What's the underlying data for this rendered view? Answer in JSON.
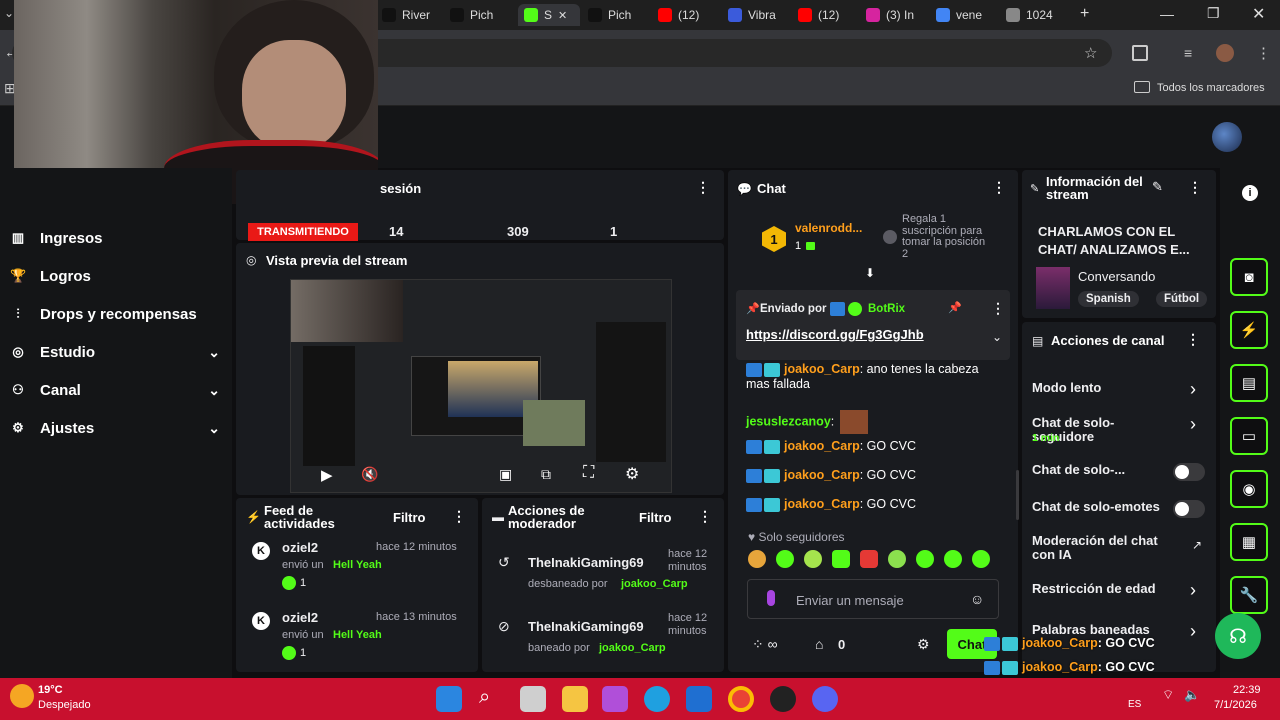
{
  "browser": {
    "tabs": [
      {
        "label": "River",
        "icon": "tiktok-icon"
      },
      {
        "label": "Pich",
        "icon": "tiktok-icon"
      },
      {
        "label": "S",
        "icon": "kick-icon",
        "active": true
      },
      {
        "label": "Pich",
        "icon": "tiktok-icon"
      },
      {
        "label": "(12)",
        "icon": "youtube-icon"
      },
      {
        "label": "Vibra",
        "icon": "gear-icon"
      },
      {
        "label": "(12)",
        "icon": "youtube-icon"
      },
      {
        "label": "(3) In",
        "icon": "instagram-icon"
      },
      {
        "label": "vene",
        "icon": "google-icon"
      },
      {
        "label": "1024",
        "icon": "globe-icon"
      }
    ],
    "new_tab": "+",
    "bookmarks_folder": "Todos los marcadores"
  },
  "session": {
    "title": "sesión",
    "status": "TRANSMITIENDO",
    "stats": [
      "14",
      "309",
      "1"
    ]
  },
  "nav": {
    "items": [
      {
        "label": "Ingresos",
        "icon": "chart-icon",
        "expandable": false
      },
      {
        "label": "Logros",
        "icon": "trophy-icon",
        "expandable": false
      },
      {
        "label": "Drops y recompensas",
        "icon": "drops-icon",
        "expandable": false
      },
      {
        "label": "Estudio",
        "icon": "studio-icon",
        "expandable": true
      },
      {
        "label": "Canal",
        "icon": "users-icon",
        "expandable": true
      },
      {
        "label": "Ajustes",
        "icon": "gear-icon",
        "expandable": true
      }
    ]
  },
  "preview": {
    "title": "Vista previa del stream"
  },
  "feed": {
    "title": "Feed de actividades",
    "filter": "Filtro",
    "items": [
      {
        "user": "oziel2",
        "time": "hace 12 minutos",
        "text": "envió un",
        "gift": "Hell Yeah",
        "count": "1"
      },
      {
        "user": "oziel2",
        "time": "hace 13 minutos",
        "text": "envió un",
        "gift": "Hell Yeah",
        "count": "1"
      }
    ]
  },
  "modactions": {
    "title": "Acciones de moderador",
    "filter": "Filtro",
    "items": [
      {
        "user": "TheInakiGaming69",
        "time": "hace 12 minutos",
        "action": "desbaneado por",
        "by": "joakoo_Carp",
        "icon": "undo-icon"
      },
      {
        "user": "TheInakiGaming69",
        "time": "hace 12 minutos",
        "action": "baneado por",
        "by": "joakoo_Carp",
        "icon": "ban-icon"
      }
    ]
  },
  "chat": {
    "title": "Chat",
    "leader": {
      "rank": "1",
      "user": "valenrodd...",
      "count": "1",
      "note": "Regala 1 suscripción para tomar la posición 2"
    },
    "pinned": {
      "label": "Enviado por",
      "sender": "BotRix",
      "link": "https://discord.gg/Fg3GgJhb"
    },
    "messages": [
      {
        "user": "joakoo_Carp",
        "text": ": ano tenes la cabeza",
        "text2": "mas fallada"
      },
      {
        "user": "jesuslezcanoy",
        "text": ":",
        "emote": true
      },
      {
        "user": "joakoo_Carp",
        "text": ": GO CVC"
      },
      {
        "user": "joakoo_Carp",
        "text": ": GO CVC"
      },
      {
        "user": "joakoo_Carp",
        "text": ": GO CVC"
      }
    ],
    "followers_only": "Solo seguidores",
    "placeholder": "Enviar un mensaje",
    "points": "0",
    "send": "Chat"
  },
  "streaminfo": {
    "title": "Información del stream",
    "stream_title": "CHARLAMOS CON EL CHAT/ ANALIZAMOS E...",
    "category": "Conversando",
    "tags": [
      "Spanish",
      "Fútbol"
    ]
  },
  "channel_actions": {
    "title": "Acciones de canal",
    "items": [
      {
        "label": "Modo lento",
        "type": "arrow"
      },
      {
        "label": "Chat de solo-seguidore",
        "sub": "1 min",
        "type": "arrow"
      },
      {
        "label": "Chat de solo-...",
        "type": "toggle"
      },
      {
        "label": "Chat de solo-emotes",
        "type": "toggle"
      },
      {
        "label": "Moderación del chat con IA",
        "type": "external"
      },
      {
        "label": "Restricción de edad",
        "type": "arrow"
      },
      {
        "label": "Palabras baneadas",
        "type": "arrow"
      }
    ]
  },
  "overlay_chat": [
    {
      "user": "joakoo_Carp",
      "text": ": GO CVC"
    },
    {
      "user": "joakoo_Carp",
      "text": ": GO CVC"
    },
    {
      "user": "joakoo_Carp",
      "text": ": GO CVC"
    }
  ],
  "taskbar": {
    "weather_temp": "19°C",
    "weather_desc": "Despejado",
    "time": "22:39",
    "date": "7/1/2026",
    "lang": "ES"
  },
  "colors": {
    "kick_green": "#53fc18",
    "live_red": "#e91916",
    "taskbar": "#c8102e"
  }
}
